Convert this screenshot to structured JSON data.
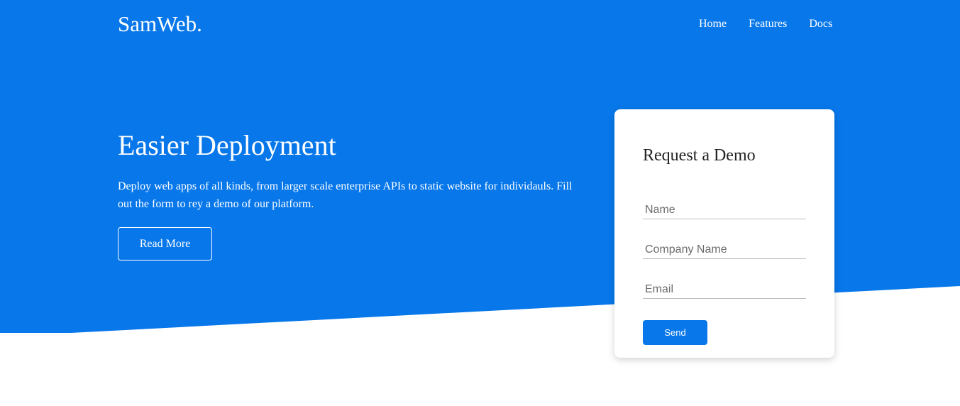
{
  "brand": {
    "logo": "SamWeb.",
    "primary_color": "#0777ea",
    "background_color": "#ffffff"
  },
  "nav": {
    "items": [
      {
        "label": "Home"
      },
      {
        "label": "Features"
      },
      {
        "label": "Docs"
      }
    ]
  },
  "hero": {
    "title": "Easier Deployment",
    "text": "Deploy web apps of all kinds, from larger scale enterprise APIs to static website for individauls. Fill out the form to rey a demo of our platform.",
    "button_label": "Read More"
  },
  "form": {
    "title": "Request a Demo",
    "name_placeholder": "Name",
    "company_placeholder": "Company Name",
    "email_placeholder": "Email",
    "name_value": "",
    "company_value": "",
    "email_value": "",
    "submit_label": "Send"
  }
}
